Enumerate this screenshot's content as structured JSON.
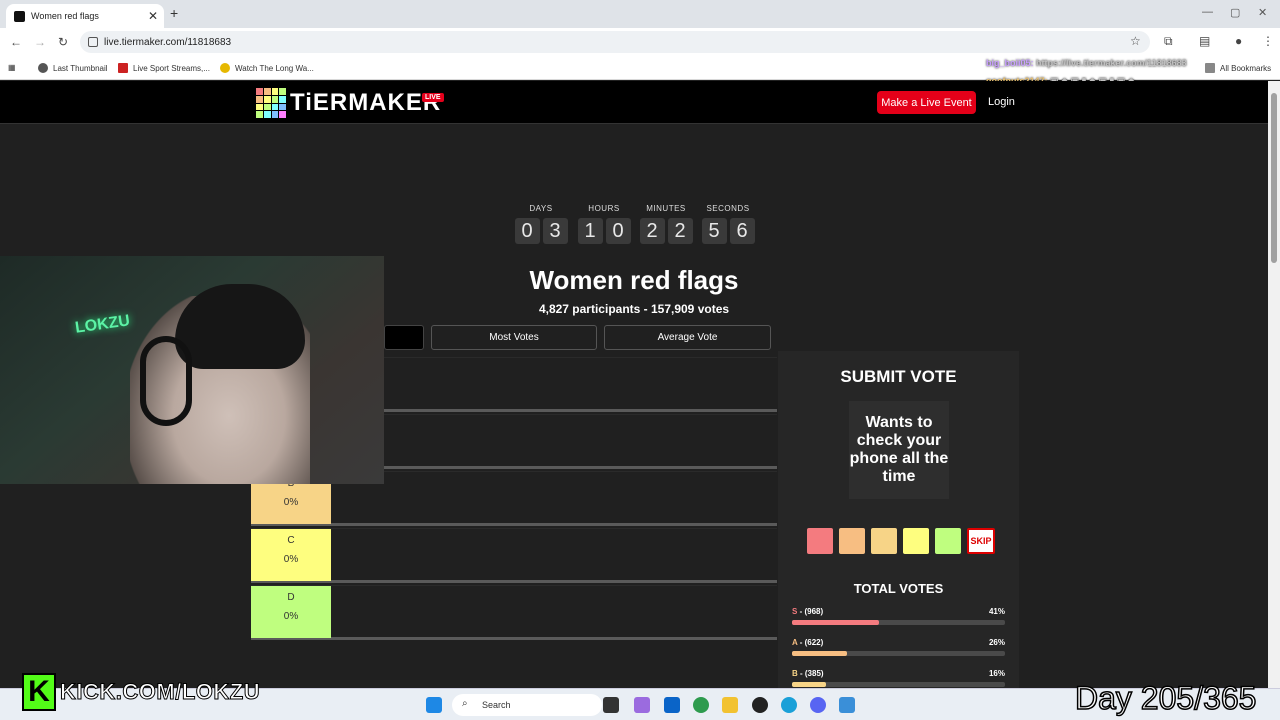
{
  "browser": {
    "tab_title": "Women red flags",
    "tab_close": "✕",
    "new_tab": "+",
    "url": "live.tiermaker.com/11818683",
    "bookmarks": [
      "Last Thumbnail",
      "Live Sport Streams,...",
      "Watch The Long Wa..."
    ],
    "all_bookmarks": "All Bookmarks"
  },
  "chat_overlay": [
    {
      "user": "big_boii05:",
      "text": "https://live.tiermaker.com/11818683"
    },
    {
      "user": "goofnuts2147:",
      "text": ""
    }
  ],
  "site": {
    "logo_text": "TiERMAKER",
    "live_badge": "LIVE",
    "make_event_label": "Make a Live Event",
    "login_label": "Login"
  },
  "countdown": [
    {
      "label": "DAYS",
      "digits": [
        "0",
        "3"
      ]
    },
    {
      "label": "HOURS",
      "digits": [
        "1",
        "0"
      ]
    },
    {
      "label": "MINUTES",
      "digits": [
        "2",
        "2"
      ]
    },
    {
      "label": "SECONDS",
      "digits": [
        "5",
        "6"
      ]
    }
  ],
  "event": {
    "title": "Women red flags",
    "stats": "4,827 participants - 157,909 votes"
  },
  "sort_tabs": [
    "Most Votes",
    "Average Vote"
  ],
  "tiers": [
    {
      "name": "B",
      "percent": "0%",
      "color": "#f7d487"
    },
    {
      "name": "C",
      "percent": "0%",
      "color": "#fefe7f"
    },
    {
      "name": "D",
      "percent": "0%",
      "color": "#bffe7f"
    }
  ],
  "vote_panel": {
    "title": "SUBMIT VOTE",
    "card_text": "Wants to check your phone all the time",
    "swatch_colors": [
      "#f47b7f",
      "#f7be82",
      "#f7d487",
      "#fefe7f",
      "#bffe7f"
    ],
    "skip_label": "SKIP",
    "total_votes_title": "TOTAL VOTES",
    "totals": [
      {
        "tier": "S",
        "count": " - (968)",
        "percent": "41%",
        "fraction": 0.41,
        "color": "#f47b7f"
      },
      {
        "tier": "A",
        "count": " - (622)",
        "percent": "26%",
        "fraction": 0.26,
        "color": "#f7be82"
      },
      {
        "tier": "B",
        "count": " - (385)",
        "percent": "16%",
        "fraction": 0.16,
        "color": "#f7d487"
      }
    ]
  },
  "overlay": {
    "kick_logo_letter": "K",
    "kick_url": "KICK.COM/LOKZU",
    "day_counter": "Day 205/365",
    "webcam_sign": "LOKZU"
  },
  "taskbar": {
    "search_placeholder": "Search"
  }
}
